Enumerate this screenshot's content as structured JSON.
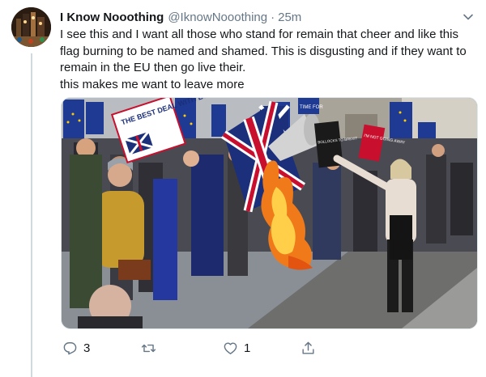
{
  "tweet": {
    "display_name": "I Know Nooothing",
    "handle": "@IknowNooothing",
    "separator": "·",
    "time": "25m",
    "text_line1": "I see this and I want all those who stand for remain that cheer and like this flag burning to be named and shamed.  This is disgusting and if they want to remain in the EU then go live their.",
    "text_line2": "this makes me want to leave more"
  },
  "image": {
    "placard_text": "THE BEST DEAL WITH EU",
    "sign_text_1": "TIME FOR",
    "sign_text_2": "I'M NOT GOING AWAY",
    "sign_text_3": "BOLLOCKS TO BREXIT"
  },
  "actions": {
    "reply_count": "3",
    "retweet_count": "",
    "like_count": "1"
  },
  "icons": {
    "caret": "chevron-down-icon",
    "reply": "reply-icon",
    "retweet": "retweet-icon",
    "like": "heart-icon",
    "share": "share-icon"
  },
  "colors": {
    "text": "#14171a",
    "secondary": "#657786",
    "eu_blue": "#1f3a93",
    "fire": "#f07a1a"
  }
}
